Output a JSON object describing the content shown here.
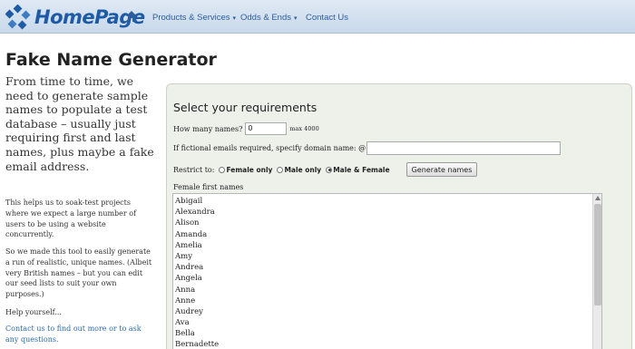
{
  "nav": {
    "logo_text": "HomePage",
    "items": [
      {
        "label": "Products & Services",
        "caret": "▾"
      },
      {
        "label": "Odds & Ends",
        "caret": "▾"
      },
      {
        "label": "Contact Us"
      }
    ]
  },
  "page": {
    "title": "Fake Name Generator",
    "intro": "From time to time, we need to generate sample names to populate a test database – usually just requiring first and last names, plus maybe a fake email address.",
    "para1": "This helps us to soak-test projects where we expect a large number of users to be using a website concurrently.",
    "para2": "So we made this tool to easily generate a run of realistic, unique names. (Albeit very British names – but you can edit our seed lists to suit your own purposes.)",
    "para3": "Help yourself...",
    "contact_link": "Contact us to find out more or to ask any questions."
  },
  "form": {
    "title": "Select your requirements",
    "count_label": "How many names?",
    "count_value": "0",
    "max_label": "max 4000",
    "domain_label": "If fictional emails required, specify domain name: @",
    "domain_value": "",
    "restrict_label": "Restrict to:",
    "options": [
      "Female only",
      "Male only",
      "Male & Female"
    ],
    "selected_option": "Male & Female",
    "generate_label": "Generate names",
    "list_label": "Female first names",
    "female_names": [
      "Abigail",
      "Alexandra",
      "Alison",
      "Amanda",
      "Amelia",
      "Amy",
      "Andrea",
      "Angela",
      "Anna",
      "Anne",
      "Audrey",
      "Ava",
      "Bella",
      "Bernadette"
    ]
  },
  "colors": {
    "accent": "#1d5ba8",
    "link": "#2a6bb3",
    "panel_bg": "#eef1ea"
  }
}
